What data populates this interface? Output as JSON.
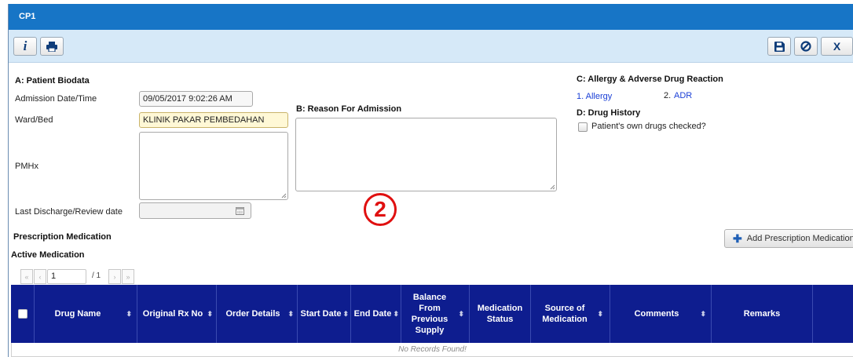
{
  "window": {
    "title": "CP1"
  },
  "toolbar": {
    "info": "info-icon",
    "print": "print-icon",
    "save": "save-icon",
    "cancel": "cancel-icon",
    "close_label": "X"
  },
  "biodata": {
    "heading": "A: Patient Biodata",
    "admission_label": "Admission Date/Time",
    "admission_value": "09/05/2017 9:02:26 AM",
    "ward_label": "Ward/Bed",
    "ward_value": "KLINIK PAKAR PEMBEDAHAN",
    "pmhx_label": "PMHx",
    "pmhx_value": "",
    "discharge_label": "Last Discharge/Review date",
    "discharge_value": ""
  },
  "reason": {
    "heading": "B: Reason For Admission",
    "value": ""
  },
  "allergy": {
    "heading": "C: Allergy & Adverse Drug Reaction",
    "item1": "1. Allergy",
    "item2_num": "2.",
    "item2_link": "ADR"
  },
  "drug_history": {
    "heading": "D: Drug History",
    "checkbox_label": "Patient's own drugs checked?"
  },
  "marker": "2",
  "prescription": {
    "heading": "Prescription Medication",
    "add_button": "Add Prescription Medication"
  },
  "active": {
    "heading": "Active Medication",
    "pager": {
      "first": "«",
      "prev": "‹",
      "page": "1",
      "of": "/ 1",
      "next": "›",
      "last": "»"
    },
    "columns": [
      "Drug Name",
      "Original Rx No",
      "Order Details",
      "Start Date",
      "End Date",
      "Balance From Previous Supply",
      "Medication Status",
      "Source of Medication",
      "Comments",
      "Remarks"
    ],
    "empty": "No Records Found!"
  },
  "colors": {
    "titlebar": "#1775c6",
    "toolbar": "#d6e9f8",
    "table_header": "#0e1d8f",
    "link": "#1a3fd6",
    "marker": "#e01010",
    "ward_bg": "#fff8d6"
  }
}
